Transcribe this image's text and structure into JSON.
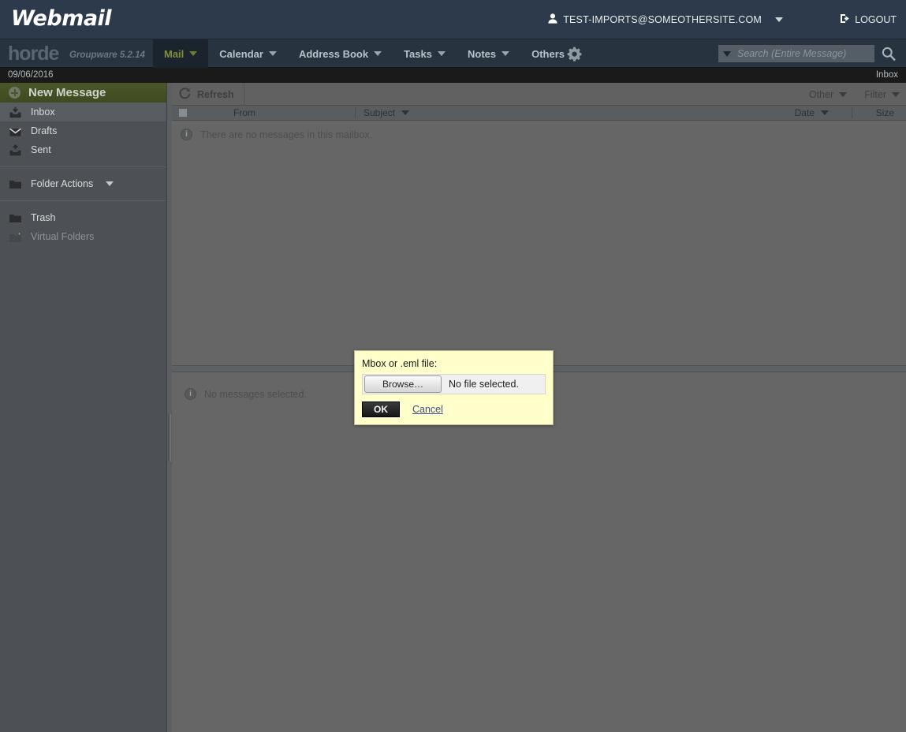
{
  "brand": {
    "title": "Webmail",
    "user_icon": "user-icon",
    "user_email": "TEST-IMPORTS@SOMEOTHERSITE.COM",
    "logout_icon": "logout-icon",
    "logout_label": "LOGOUT",
    "bg_color": "#2c3a4b"
  },
  "nav": {
    "app_logo": "horde",
    "app_version": "Groupware 5.2.14",
    "tabs": [
      {
        "label": "Mail",
        "active": true
      },
      {
        "label": "Calendar",
        "active": false
      },
      {
        "label": "Address Book",
        "active": false
      },
      {
        "label": "Tasks",
        "active": false
      },
      {
        "label": "Notes",
        "active": false
      },
      {
        "label": "Others",
        "active": false
      }
    ],
    "gear_icon": "gear-icon",
    "active_color": "#7f8f3a",
    "bg_color": "#27333f"
  },
  "search": {
    "placeholder": "Search (Entire Message)",
    "value": "",
    "dropdown_icon": "caret-down-icon",
    "search_icon": "search-icon"
  },
  "strip": {
    "date": "09/06/2016",
    "mailbox_label": "Inbox"
  },
  "sidebar": {
    "new_message": {
      "label": "New Message",
      "icon": "plus-circle-icon"
    },
    "folders": [
      {
        "label": "Inbox",
        "icon": "inbox-icon",
        "selected": true,
        "dim": false
      },
      {
        "label": "Drafts",
        "icon": "drafts-envelope-icon",
        "selected": false,
        "dim": false
      },
      {
        "label": "Sent",
        "icon": "sent-icon",
        "selected": false,
        "dim": false
      }
    ],
    "folder_actions": {
      "label": "Folder Actions",
      "icon": "folder-icon"
    },
    "special": [
      {
        "label": "Trash",
        "icon": "folder-icon",
        "dim": false
      },
      {
        "label": "Virtual Folders",
        "icon": "folder-plus-icon",
        "dim": true
      }
    ],
    "bg_color": "#4d5155"
  },
  "toolbar": {
    "refresh_label": "Refresh",
    "refresh_icon": "refresh-icon",
    "other_label": "Other",
    "filter_label": "Filter"
  },
  "message_list": {
    "columns": {
      "from": "From",
      "subject": "Subject",
      "date": "Date",
      "size": "Size"
    },
    "sorted_column": "Subject",
    "empty_message": "There are no messages in this mailbox.",
    "info_icon": "info-icon",
    "select_all_checkbox": "select-all-checkbox"
  },
  "preview": {
    "empty_message": "No messages selected.",
    "info_icon": "info-icon"
  },
  "dialog": {
    "label": "Mbox or .eml file:",
    "browse_label": "Browse…",
    "file_status": "No file selected.",
    "ok_label": "OK",
    "cancel_label": "Cancel",
    "bg_color": "#ffffcc"
  }
}
